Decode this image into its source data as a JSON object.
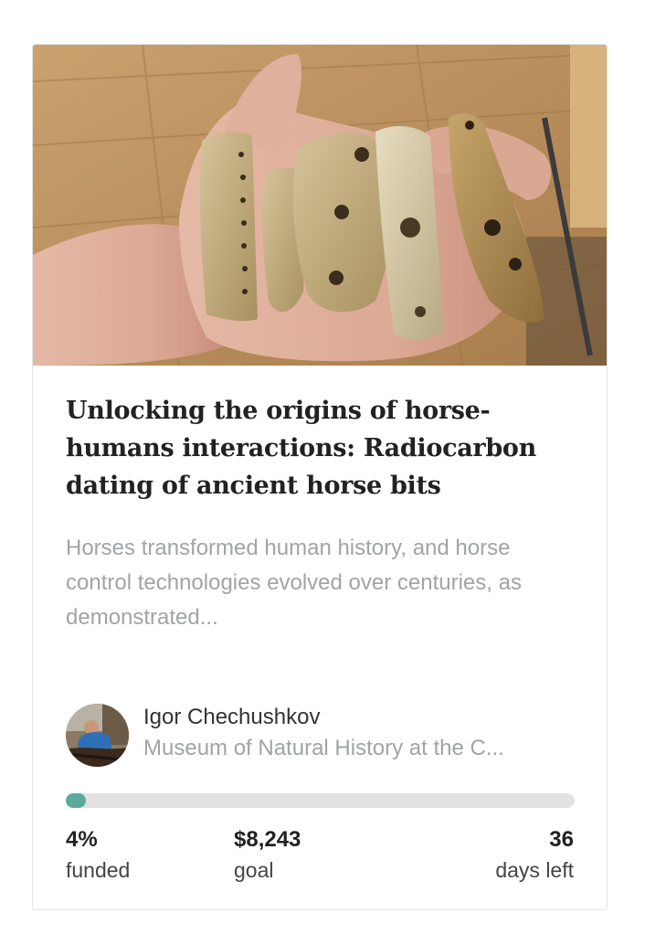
{
  "project": {
    "title": "Unlocking the origins of horse-humans interactions: Radiocarbon dating of ancient horse bits",
    "description": "Horses transformed human history, and horse control technologies evolved over centuries, as demonstrated...",
    "image": "hand-holding-ancient-horse-bit-artifacts"
  },
  "author": {
    "name": "Igor Chechushkov",
    "organization": "Museum of Natural History at the C...",
    "avatar": "researcher-photo"
  },
  "progress": {
    "fraction": 0.04,
    "color": "#5aa99a",
    "track_color": "#e2e2e2"
  },
  "stats": {
    "funded_value": "4%",
    "funded_label": "funded",
    "goal_value": "$8,243",
    "goal_label": "goal",
    "days_value": "36",
    "days_label": "days left"
  }
}
